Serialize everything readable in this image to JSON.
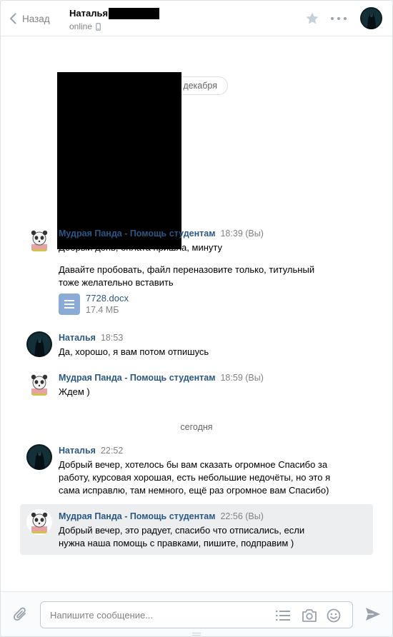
{
  "header": {
    "back_label": "Назад",
    "peer_name": "Наталья",
    "peer_status": "online"
  },
  "history": {
    "top_date_partial": "декабря",
    "date_today": "сегодня"
  },
  "messages": [
    {
      "author": "Мудрая Панда - Помощь студентам",
      "time": "18:39 (Вы)",
      "lines": [
        "Добрый день, оплата пришла, минуту"
      ],
      "lines2": [
        "Давайте пробовать, файл переназовите только, титульный",
        "тоже желательно вставить"
      ],
      "doc": {
        "name": "7728.docx",
        "size": "17.4 МБ"
      }
    },
    {
      "author": "Наталья",
      "time": "18:53",
      "lines": [
        "Да, хорошо, я вам потом отпишусь"
      ]
    },
    {
      "author": "Мудрая Панда - Помощь студентам",
      "time": "18:59 (Вы)",
      "lines": [
        "Ждем )"
      ]
    },
    {
      "author": "Наталья",
      "time": "22:52",
      "lines": [
        "Добрый вечер, хотелось бы вам сказать огромное Спасибо за",
        "работу, курсовая хорошая, есть небольшие недочёты, но это я",
        "сама исправлю, там немного, ещё раз огромное вам Спасибо)"
      ]
    },
    {
      "author": "Мудрая Панда - Помощь студентам",
      "time": "22:56 (Вы)",
      "lines": [
        "Добрый вечер, это радует, спасибо что отписались, если",
        "нужна наша помощь с правками, пишите, подправим )"
      ]
    }
  ],
  "composer": {
    "placeholder": "Напишите сообщение..."
  },
  "colors": {
    "link": "#2a5885",
    "muted": "#828282",
    "selected_bg": "#edeef0",
    "doc_icon": "#8aabd6"
  }
}
